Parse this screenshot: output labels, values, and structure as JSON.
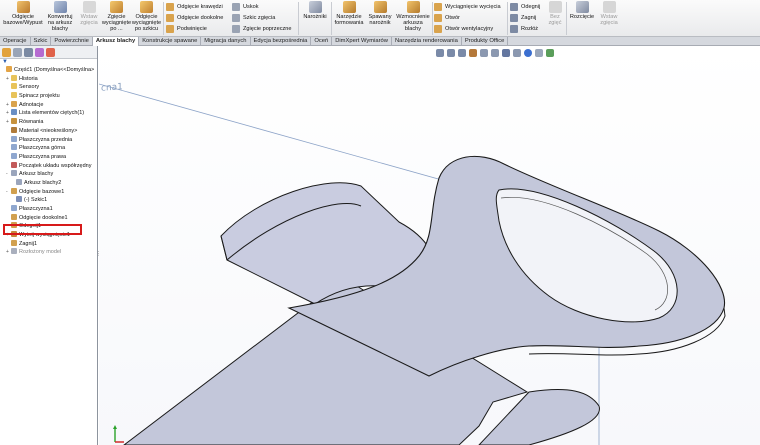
{
  "ribbon": {
    "buttons": [
      {
        "label": "Odgięcie\nbazowe/Wypust",
        "enabled": true
      },
      {
        "label": "Konwertuj\nna arkusz\nblachy",
        "enabled": true
      },
      {
        "label": "Wstaw\nzgięcia",
        "enabled": false
      },
      {
        "label": "Zgięcie\nwyciągnięte po ...",
        "enabled": true
      },
      {
        "label": "Odgięcie\nwyciągnięte\npo szkicu",
        "enabled": true
      }
    ],
    "group2": [
      "Odgięcie krawędzi",
      "Odgięcie dookolne",
      "Podwinięcie"
    ],
    "group3": [
      "Uskok",
      "Szkic zgięcia",
      "Zgięcie poprzeczne"
    ],
    "naroznik": "Narożniki",
    "group4": [
      {
        "label": "Narzędzie\nformowania"
      },
      {
        "label": "Spawany\nnarożnik"
      },
      {
        "label": "Wzmocnienie\narkusza\nblachy"
      }
    ],
    "group5": [
      "Wyciągnięcie wycięcia",
      "Otwór",
      "Otwór wentylacyjny"
    ],
    "group6": [
      "Odegnij",
      "Zagnij",
      "Rozłóż"
    ],
    "bez_zgiec": "Bez\nzgięć",
    "rozciecie": "Rozcięcie",
    "wstaw_zgiecia2": "Wstaw\nzgięcia"
  },
  "tabs": [
    {
      "label": "Operacje",
      "active": false
    },
    {
      "label": "Szkic",
      "active": false
    },
    {
      "label": "Powierzchnie",
      "active": false
    },
    {
      "label": "Arkusz blachy",
      "active": true
    },
    {
      "label": "Konstrukcje spawane",
      "active": false
    },
    {
      "label": "Migracja danych",
      "active": false
    },
    {
      "label": "Edycja bezpośrednia",
      "active": false
    },
    {
      "label": "Oceń",
      "active": false
    },
    {
      "label": "DimXpert Wymiarów",
      "active": false
    },
    {
      "label": "Narzędzia renderowania",
      "active": false
    },
    {
      "label": "Produkty Office",
      "active": false
    }
  ],
  "tree": [
    {
      "label": "Część1  (Domyślna<<Domyślna>",
      "indent": 0,
      "expander": "",
      "icon": "part",
      "grey": false
    },
    {
      "label": "Historia",
      "indent": 1,
      "expander": "+",
      "icon": "folder",
      "grey": false
    },
    {
      "label": "Sensory",
      "indent": 1,
      "expander": "",
      "icon": "folder",
      "grey": false
    },
    {
      "label": "Spinacz projektu",
      "indent": 1,
      "expander": "",
      "icon": "folder",
      "grey": false
    },
    {
      "label": "Adnotacje",
      "indent": 1,
      "expander": "+",
      "icon": "annot",
      "grey": false
    },
    {
      "label": "Lista elementów ciętych(1)",
      "indent": 1,
      "expander": "+",
      "icon": "list",
      "grey": false
    },
    {
      "label": "Równania",
      "indent": 1,
      "expander": "+",
      "icon": "eq",
      "grey": false
    },
    {
      "label": "Materiał <nieokreślony>",
      "indent": 1,
      "expander": "",
      "icon": "mat",
      "grey": false
    },
    {
      "label": "Płaszczyzna przednia",
      "indent": 1,
      "expander": "",
      "icon": "plane",
      "grey": false
    },
    {
      "label": "Płaszczyzna górna",
      "indent": 1,
      "expander": "",
      "icon": "plane",
      "grey": false
    },
    {
      "label": "Płaszczyzna prawa",
      "indent": 1,
      "expander": "",
      "icon": "plane",
      "grey": false
    },
    {
      "label": "Początek układu współrzędny",
      "indent": 1,
      "expander": "",
      "icon": "origin",
      "grey": false
    },
    {
      "label": "Arkusz blachy",
      "indent": 1,
      "expander": "-",
      "icon": "sheet",
      "grey": false
    },
    {
      "label": "Arkusz blachy2",
      "indent": 2,
      "expander": "",
      "icon": "sheet",
      "grey": false
    },
    {
      "label": "Odgięcie bazowe1",
      "indent": 1,
      "expander": "-",
      "icon": "feat",
      "grey": false
    },
    {
      "label": "(-) Szkic1",
      "indent": 2,
      "expander": "",
      "icon": "sketch",
      "grey": false
    },
    {
      "label": "Płaszczyzna1",
      "indent": 1,
      "expander": "",
      "icon": "plane",
      "grey": false
    },
    {
      "label": "Odgięcie dookolne1",
      "indent": 1,
      "expander": "",
      "icon": "feat",
      "grey": false
    },
    {
      "label": "Odegnij1",
      "indent": 1,
      "expander": "",
      "icon": "feat",
      "grey": false
    },
    {
      "label": "Wytnij-wyciągnięcie1",
      "indent": 1,
      "expander": "+",
      "icon": "cut",
      "grey": false
    },
    {
      "label": "Zagnij1",
      "indent": 1,
      "expander": "",
      "icon": "feat",
      "grey": false
    },
    {
      "label": "Rozłożony model",
      "indent": 1,
      "expander": "+",
      "icon": "flat",
      "grey": true
    }
  ],
  "plane_label": "cna1",
  "colors": {
    "accent": "#2a5db0",
    "highlight": "#d71a1a",
    "model_fill": "#c2c6d9",
    "model_edge": "#1a1a1a"
  }
}
